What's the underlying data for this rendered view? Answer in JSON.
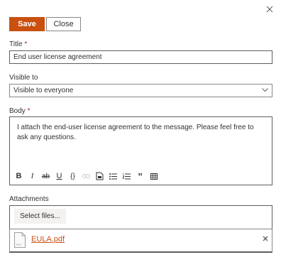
{
  "toolbar": {
    "save_label": "Save",
    "close_label": "Close"
  },
  "title_field": {
    "label": "Title",
    "required_mark": "*",
    "value": "End user license agreement"
  },
  "visible_field": {
    "label": "Visible to",
    "value": "Visible to everyone"
  },
  "body_field": {
    "label": "Body",
    "required_mark": "*",
    "value": "I attach the end-user license agreement to the message. Please feel free to ask any questions."
  },
  "editor_toolbar": {
    "bold": "B",
    "italic": "I",
    "strikethrough": "ab",
    "underline": "U",
    "code": "{}",
    "quote": "”"
  },
  "attachments": {
    "label": "Attachments",
    "select_files_label": "Select files...",
    "file": {
      "name": "EULA.pdf",
      "type_badge": "PDF"
    }
  },
  "colors": {
    "accent": "#ca5010",
    "required": "#a4262c"
  }
}
